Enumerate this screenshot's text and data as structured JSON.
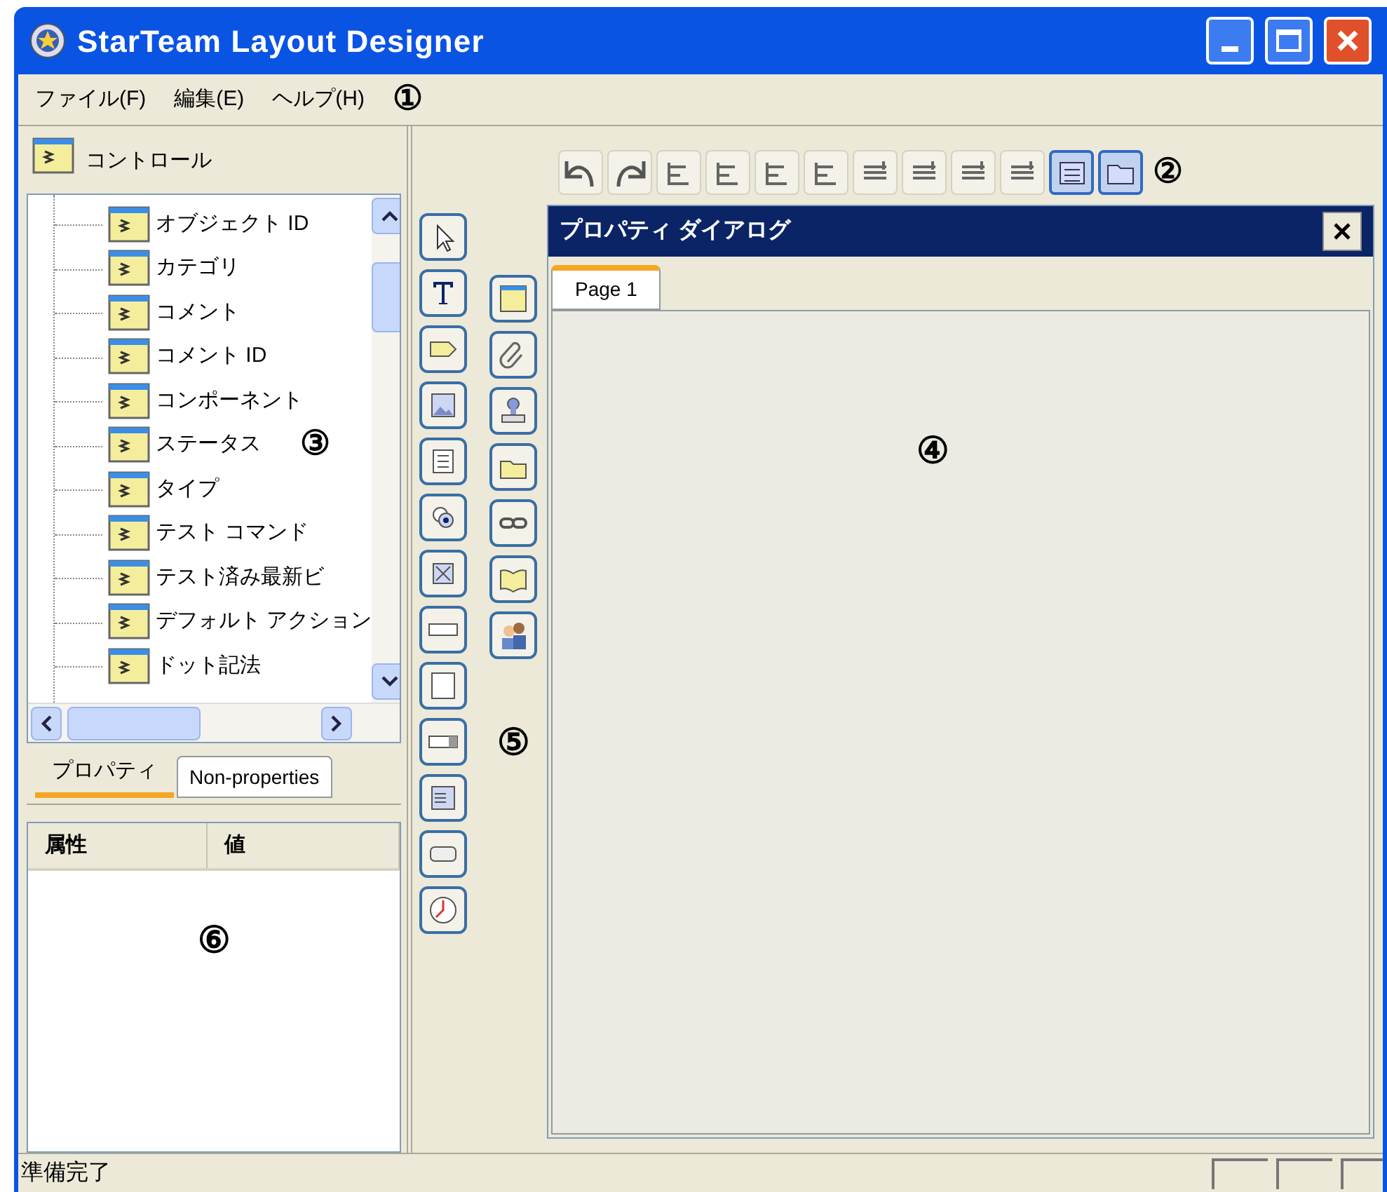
{
  "window": {
    "title": "StarTeam Layout Designer"
  },
  "menu": {
    "items": [
      "ファイル(F)",
      "編集(E)",
      "ヘルプ(H)"
    ],
    "callout": "①"
  },
  "controls_panel": {
    "title": "コントロール",
    "callout": "③",
    "tree": [
      "オブジェクト ID",
      "カテゴリ",
      "コメント",
      "コメント ID",
      "コンポーネント",
      "ステータス",
      "タイプ",
      "テスト コマンド",
      "テスト済み最新ビ",
      "デフォルト アクション",
      "ドット記法"
    ]
  },
  "panel_tabs": [
    {
      "label": "プロパティ",
      "selected": true
    },
    {
      "label": "Non-properties",
      "selected": false
    }
  ],
  "properties_table": {
    "columns": [
      "属性",
      "値"
    ],
    "callout": "⑥"
  },
  "toolbar": {
    "callout": "②",
    "buttons": [
      {
        "kind": "undo",
        "selected": false
      },
      {
        "kind": "redo",
        "selected": false
      },
      {
        "kind": "align",
        "selected": false
      },
      {
        "kind": "align",
        "selected": false
      },
      {
        "kind": "align",
        "selected": false
      },
      {
        "kind": "align",
        "selected": false
      },
      {
        "kind": "space",
        "selected": false
      },
      {
        "kind": "space",
        "selected": false
      },
      {
        "kind": "space",
        "selected": false
      },
      {
        "kind": "space",
        "selected": false
      },
      {
        "kind": "form",
        "selected": true
      },
      {
        "kind": "folder",
        "selected": true
      }
    ]
  },
  "toolbox": {
    "callout": "⑤",
    "column_1": [
      {
        "kind": "pointer"
      },
      {
        "kind": "text"
      },
      {
        "kind": "label"
      },
      {
        "kind": "image"
      },
      {
        "kind": "list"
      },
      {
        "kind": "radio"
      },
      {
        "kind": "checkbox"
      },
      {
        "kind": "textfield"
      },
      {
        "kind": "textarea"
      },
      {
        "kind": "combo"
      },
      {
        "kind": "spinner"
      },
      {
        "kind": "button"
      },
      {
        "kind": "clock"
      }
    ],
    "column_2": [
      {
        "kind": "control"
      },
      {
        "kind": "attachment"
      },
      {
        "kind": "stamp"
      },
      {
        "kind": "folder"
      },
      {
        "kind": "link"
      },
      {
        "kind": "book"
      },
      {
        "kind": "people"
      }
    ]
  },
  "dialog": {
    "title": "プロパティ ダイアログ",
    "callout": "④",
    "tabs": [
      {
        "label": "Page 1",
        "selected": true
      }
    ]
  },
  "status_bar": {
    "text": "準備完了"
  }
}
